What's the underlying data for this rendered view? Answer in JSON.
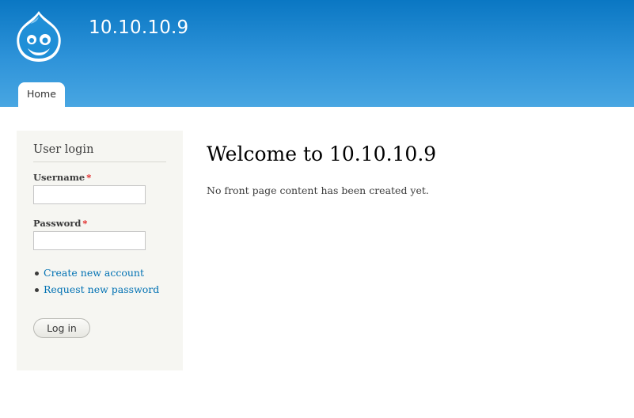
{
  "header": {
    "site_name": "10.10.10.9",
    "logo_icon": "drupal-drop-logo-icon"
  },
  "main_menu": {
    "items": [
      {
        "label": "Home"
      }
    ]
  },
  "sidebar": {
    "block_title": "User login",
    "username_label": "Username",
    "password_label": "Password",
    "required_marker": "*",
    "username_value": "",
    "password_value": "",
    "links": [
      {
        "label": "Create new account"
      },
      {
        "label": "Request new password"
      }
    ],
    "login_button": "Log in"
  },
  "content": {
    "title": "Welcome to 10.10.10.9",
    "body": "No front page content has been created yet."
  },
  "colors": {
    "header_top": "#0a77c3",
    "header_bottom": "#48a6e2",
    "link": "#0071b3",
    "required": "#e12020",
    "sidebar_bg": "#f6f6f2"
  }
}
